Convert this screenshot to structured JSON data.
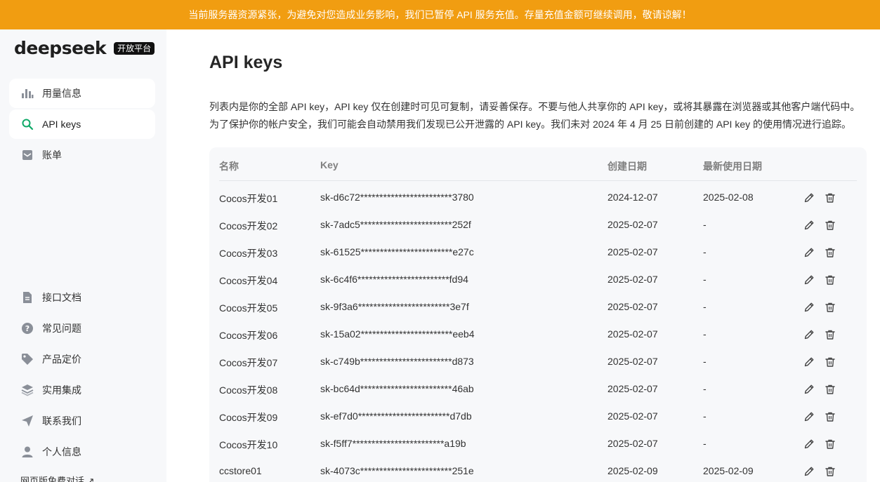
{
  "banner": {
    "text": "当前服务器资源紧张，为避免对您造成业务影响，我们已暂停 API 服务充值。存量充值金额可继续调用，敬请谅解！"
  },
  "logo": {
    "word": "deepseek",
    "badge": "开放平台"
  },
  "sidebar": {
    "top_items": [
      {
        "label": "用量信息",
        "icon": "bar-chart-icon"
      },
      {
        "label": "API keys",
        "icon": "search-key-icon"
      },
      {
        "label": "账单",
        "icon": "bill-icon"
      }
    ],
    "bottom_items": [
      {
        "label": "接口文档",
        "icon": "document-icon"
      },
      {
        "label": "常见问题",
        "icon": "question-icon"
      },
      {
        "label": "产品定价",
        "icon": "price-tag-icon"
      },
      {
        "label": "实用集成",
        "icon": "layers-icon"
      },
      {
        "label": "联系我们",
        "icon": "send-icon"
      },
      {
        "label": "个人信息",
        "icon": "user-icon"
      }
    ],
    "web_chat_link": "网页版免费对话 ↗"
  },
  "main": {
    "title": "API keys",
    "description_line1": "列表内是你的全部 API key，API key 仅在创建时可见可复制，请妥善保存。不要与他人共享你的 API key，或将其暴露在浏览器或其他客户端代码中。",
    "description_line2": "为了保护你的帐户安全，我们可能会自动禁用我们发现已公开泄露的 API key。我们未对 2024 年 4 月 25 日前创建的 API key 的使用情况进行追踪。"
  },
  "table": {
    "headers": {
      "name": "名称",
      "key": "Key",
      "created": "创建日期",
      "last_used": "最新使用日期"
    },
    "rows": [
      {
        "name": "Cocos开发01",
        "key": "sk-d6c72************************3780",
        "created": "2024-12-07",
        "last_used": "2025-02-08"
      },
      {
        "name": "Cocos开发02",
        "key": "sk-7adc5************************252f",
        "created": "2025-02-07",
        "last_used": "-"
      },
      {
        "name": "Cocos开发03",
        "key": "sk-61525************************e27c",
        "created": "2025-02-07",
        "last_used": "-"
      },
      {
        "name": "Cocos开发04",
        "key": "sk-6c4f6************************fd94",
        "created": "2025-02-07",
        "last_used": "-"
      },
      {
        "name": "Cocos开发05",
        "key": "sk-9f3a6************************3e7f",
        "created": "2025-02-07",
        "last_used": "-"
      },
      {
        "name": "Cocos开发06",
        "key": "sk-15a02************************eeb4",
        "created": "2025-02-07",
        "last_used": "-"
      },
      {
        "name": "Cocos开发07",
        "key": "sk-c749b************************d873",
        "created": "2025-02-07",
        "last_used": "-"
      },
      {
        "name": "Cocos开发08",
        "key": "sk-bc64d************************46ab",
        "created": "2025-02-07",
        "last_used": "-"
      },
      {
        "name": "Cocos开发09",
        "key": "sk-ef7d0************************d7db",
        "created": "2025-02-07",
        "last_used": "-"
      },
      {
        "name": "Cocos开发10",
        "key": "sk-f5ff7************************a19b",
        "created": "2025-02-07",
        "last_used": "-"
      },
      {
        "name": "ccstore01",
        "key": "sk-4073c************************251e",
        "created": "2025-02-09",
        "last_used": "2025-02-09"
      }
    ]
  },
  "colors": {
    "banner": "#f19d11",
    "accent": "#0fa968",
    "sidebar_bg": "#f7f8fa",
    "table_bg": "#f7f8fa"
  }
}
